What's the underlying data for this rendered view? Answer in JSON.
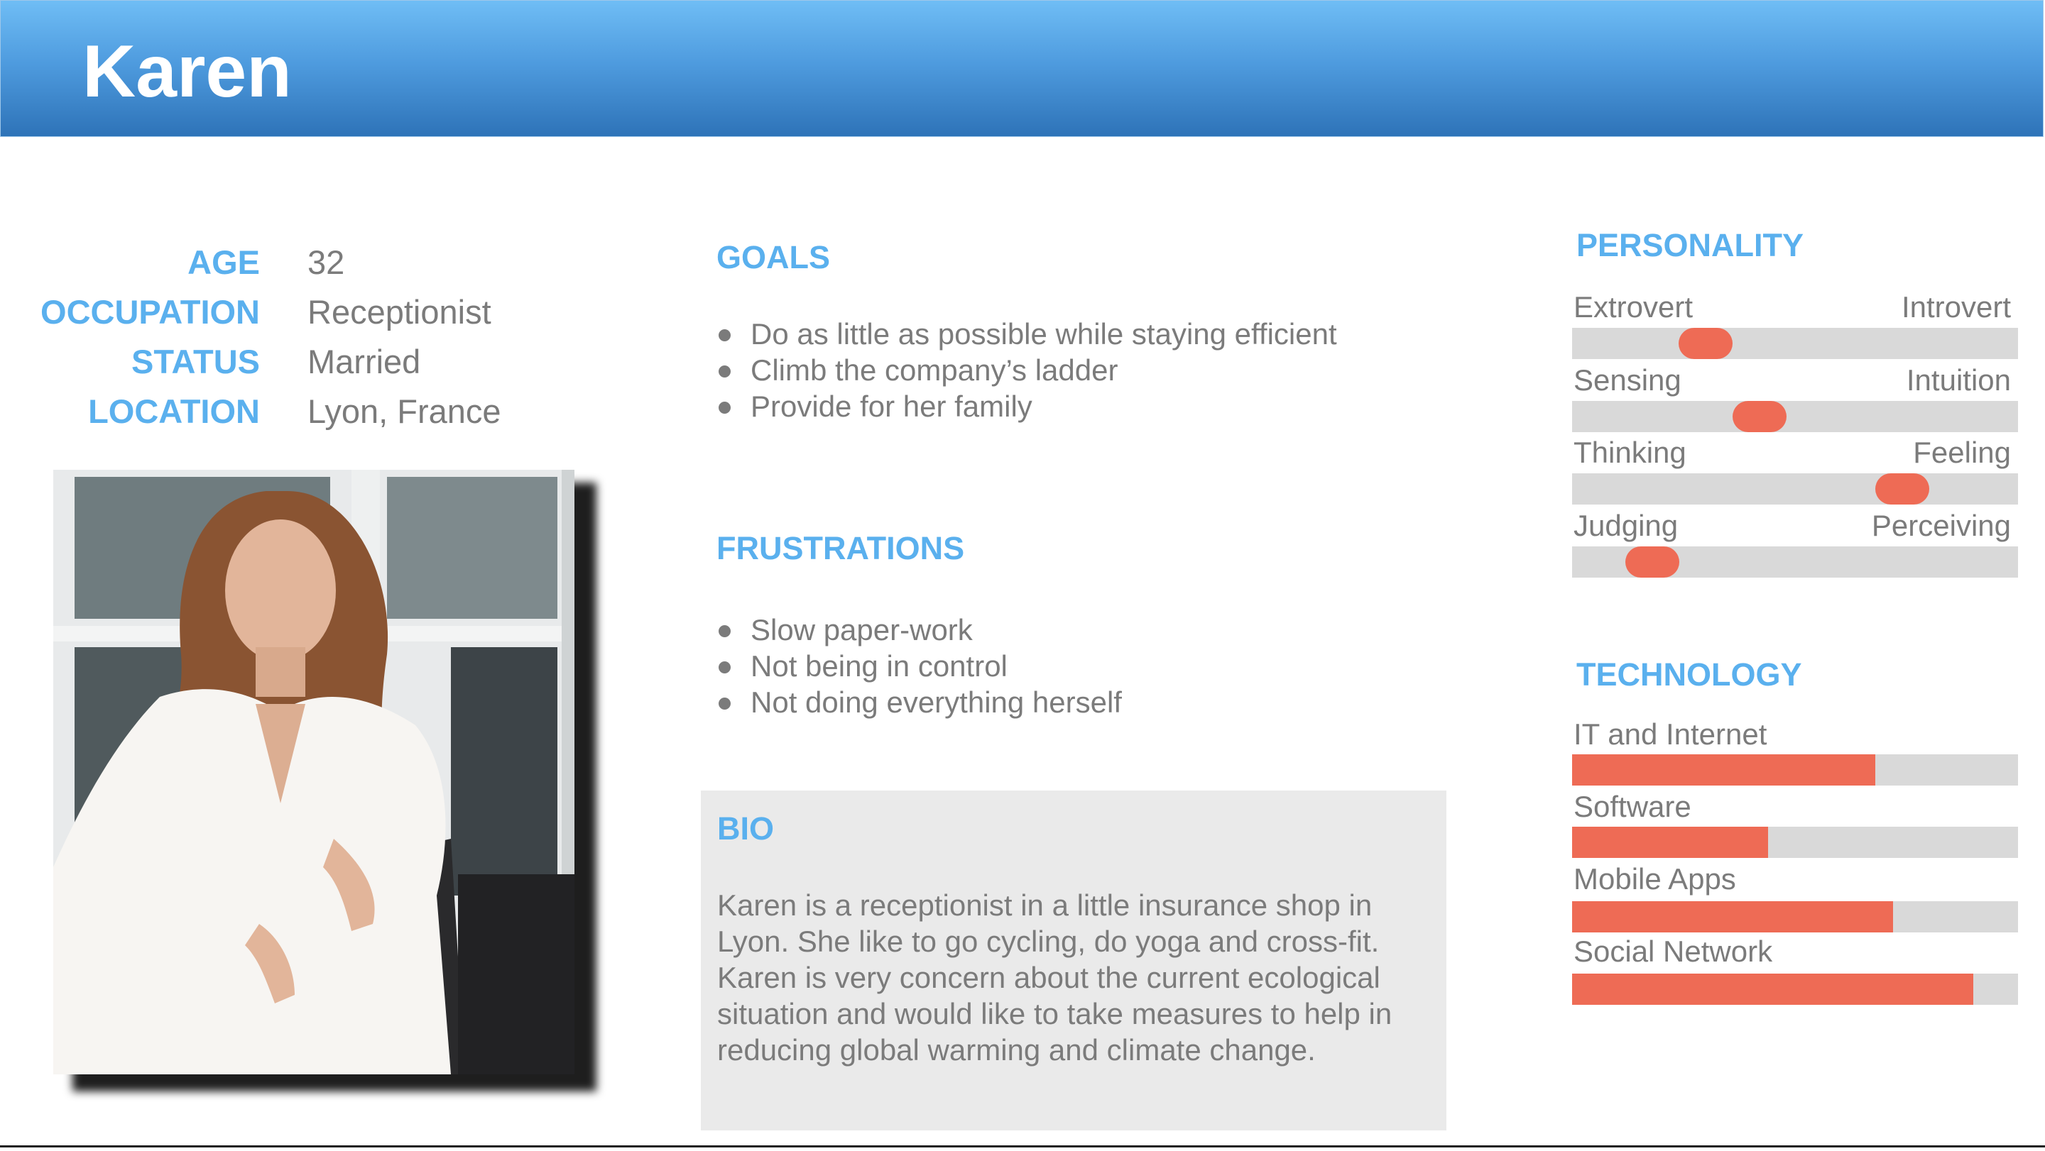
{
  "persona": {
    "name": "Karen"
  },
  "info": [
    {
      "label": "AGE",
      "value": "32"
    },
    {
      "label": "OCCUPATION",
      "value": "Receptionist"
    },
    {
      "label": "STATUS",
      "value": "Married"
    },
    {
      "label": "LOCATION",
      "value": "Lyon, France"
    }
  ],
  "goals": {
    "title": "GOALS",
    "items": [
      "Do as little as possible while staying efficient",
      "Climb the company’s ladder",
      "Provide for her family"
    ]
  },
  "frustrations": {
    "title": "FRUSTRATIONS",
    "items": [
      "Slow paper-work",
      "Not being in control",
      "Not doing everything herself"
    ]
  },
  "bio": {
    "title": "BIO",
    "text": "Karen is a receptionist in a little insurance shop in Lyon. She like to go cycling, do yoga and cross-fit. Karen is very concern about the current ecological situation and would like to take measures to help in reducing global warming and climate change."
  },
  "personality": {
    "title": "PERSONALITY",
    "traits": [
      {
        "left": "Extrovert",
        "right": "Introvert",
        "position": 0.3
      },
      {
        "left": "Sensing",
        "right": "Intuition",
        "position": 0.42
      },
      {
        "left": "Thinking",
        "right": "Feeling",
        "position": 0.74
      },
      {
        "left": "Judging",
        "right": "Perceiving",
        "position": 0.18
      }
    ]
  },
  "technology": {
    "title": "TECHNOLOGY",
    "items": [
      {
        "label": "IT and Internet",
        "level": 0.68
      },
      {
        "label": "Software",
        "level": 0.44
      },
      {
        "label": "Mobile Apps",
        "level": 0.72
      },
      {
        "label": "Social Network",
        "level": 0.9
      }
    ]
  },
  "colors": {
    "accent_blue": "#5ab0ee",
    "accent_orange": "#ee6b55",
    "track_gray": "#d9d9d9",
    "bio_background": "#eaeaea"
  }
}
